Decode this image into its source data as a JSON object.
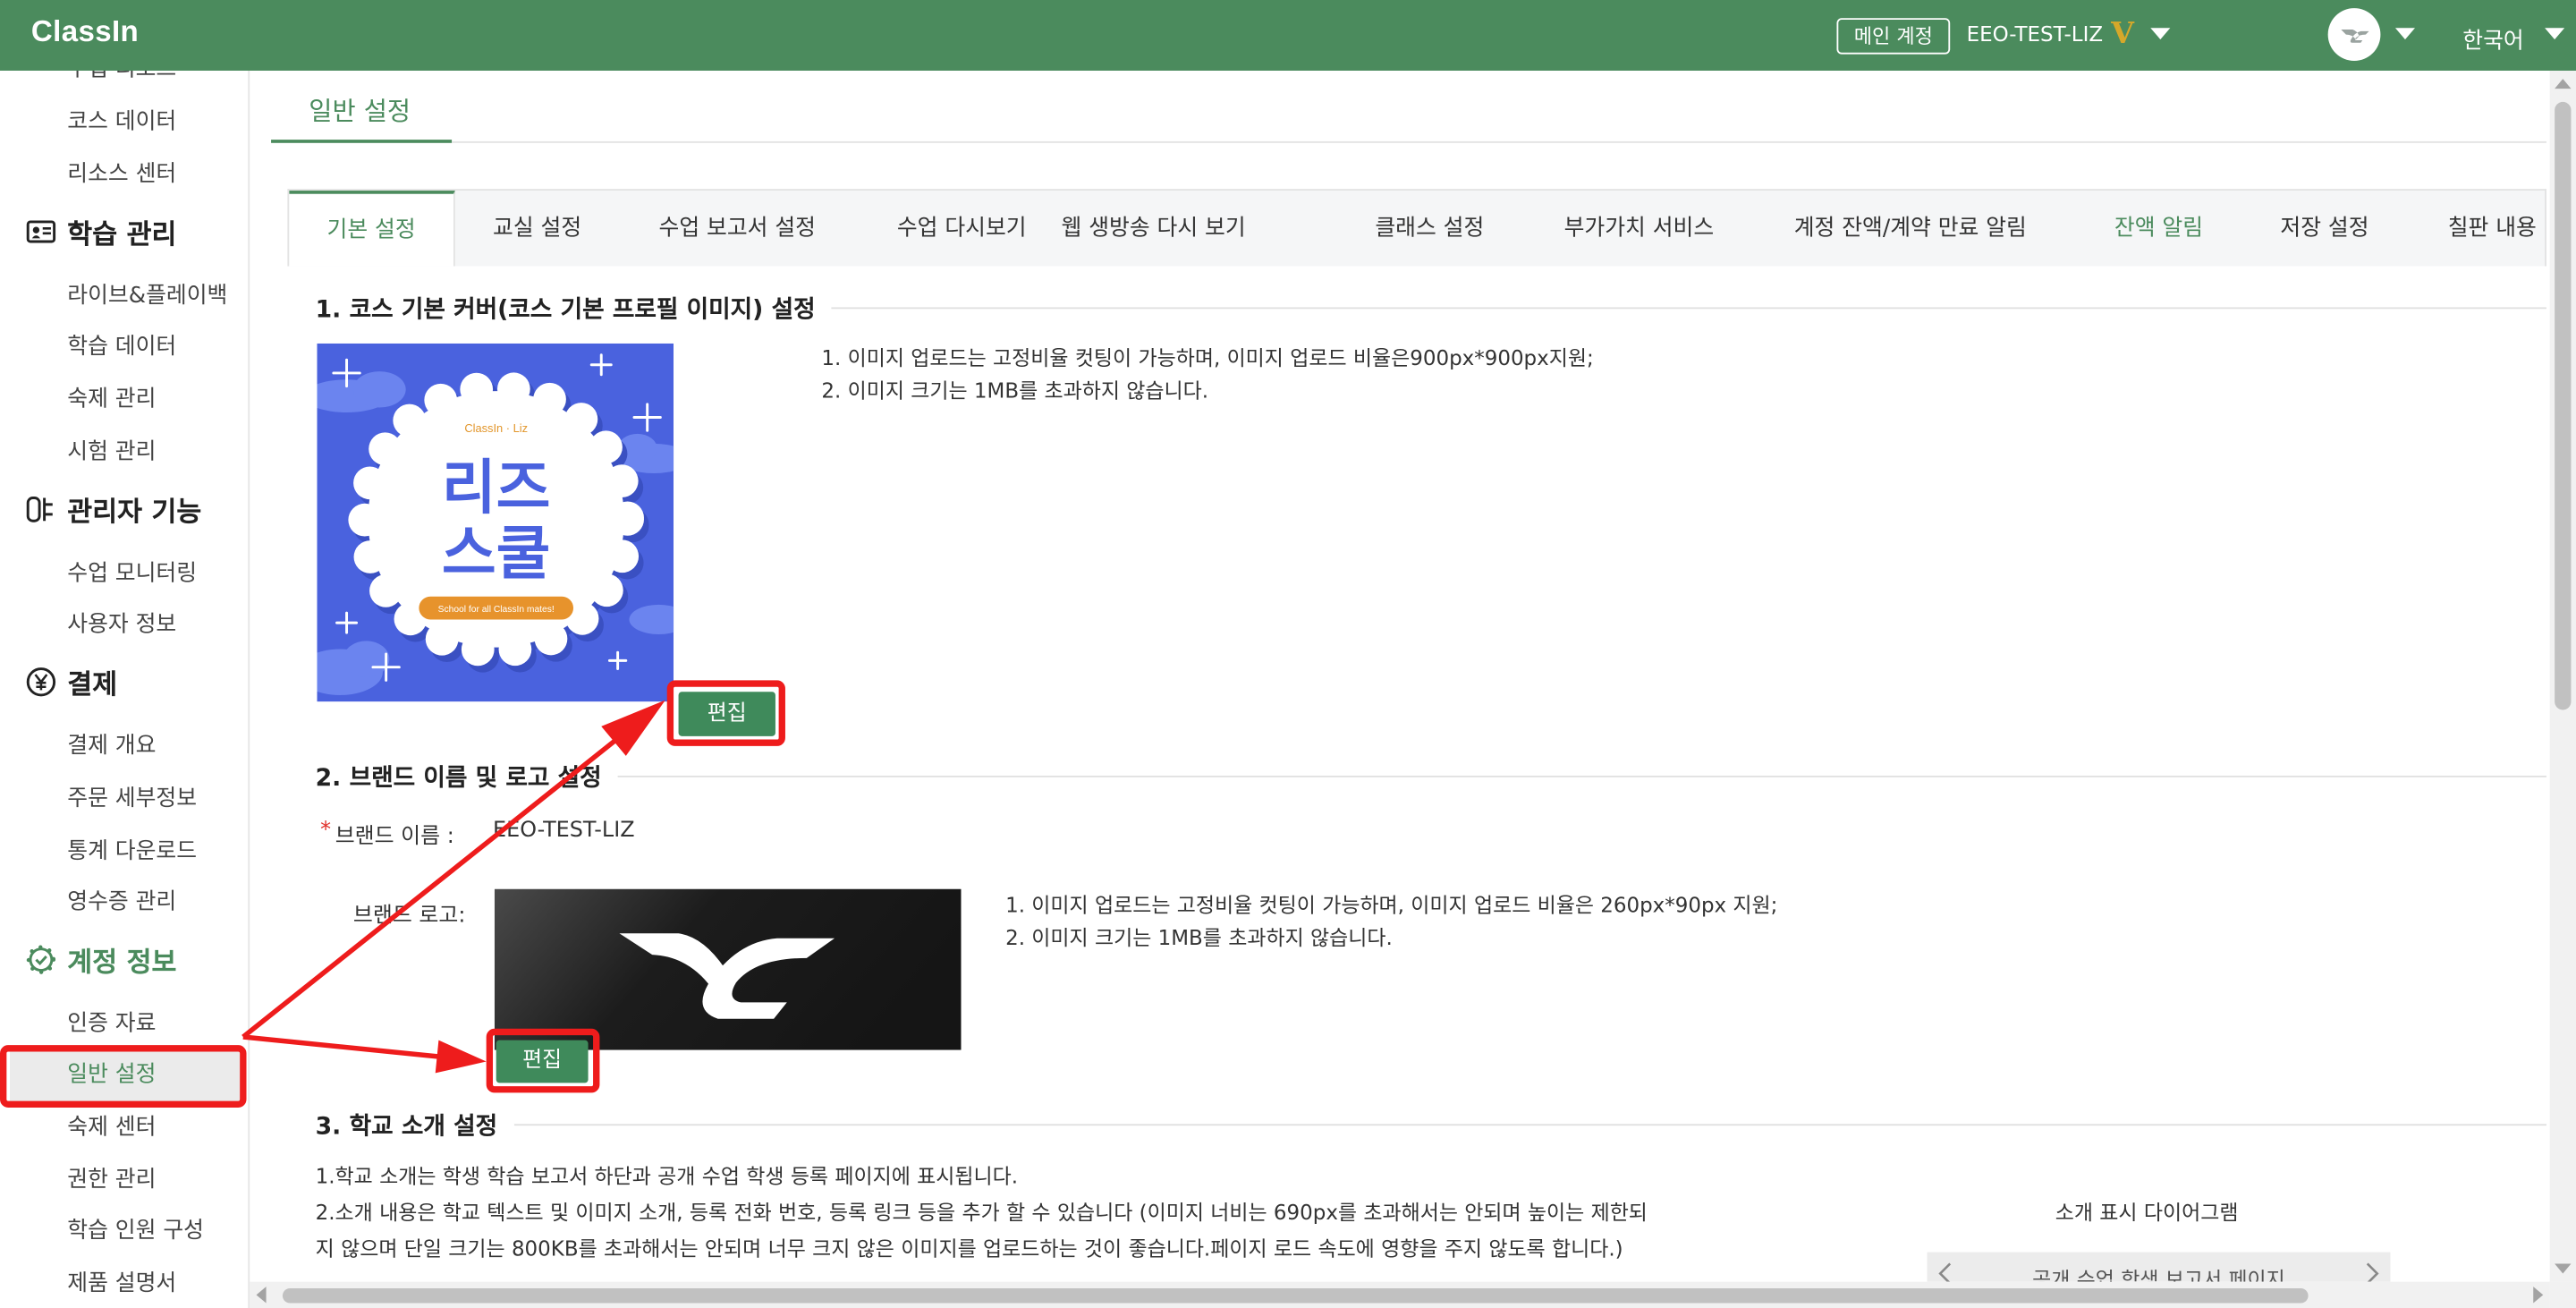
{
  "header": {
    "logo": "ClassIn",
    "main_account_label": "메인 계정",
    "account_name": "EEO-TEST-LIZ",
    "vip_badge": "V",
    "language": "한국어"
  },
  "sidebar": {
    "groups": [
      {
        "title": "",
        "items": [
          "수업 리소스",
          "코스 데이터",
          "리소스 센터"
        ]
      },
      {
        "title": "학습 관리",
        "icon": "id-card-icon",
        "items": [
          "라이브&플레이백",
          "학습 데이터",
          "숙제 관리",
          "시험 관리"
        ]
      },
      {
        "title": "관리자 기능",
        "icon": "admin-icon",
        "items": [
          "수업 모니터링",
          "사용자 정보"
        ]
      },
      {
        "title": "결제",
        "icon": "yen-icon",
        "items": [
          "결제 개요",
          "주문 세부정보",
          "통계 다운로드",
          "영수증 관리"
        ]
      },
      {
        "title": "계정 정보",
        "icon": "account-badge-icon",
        "items": [
          "인증 자료",
          "일반 설정",
          "숙제 센터",
          "권한 관리",
          "학습 인원 구성",
          "제품 설명서"
        ]
      }
    ],
    "active_item": "일반 설정"
  },
  "page": {
    "title": "일반 설정",
    "tabs": [
      "기본 설정",
      "교실 설정",
      "수업 보고서 설정",
      "수업 다시보기",
      "웹 생방송 다시 보기",
      "클래스 설정",
      "부가가치 서비스",
      "계정 잔액/계약 만료 알림",
      "잔액 알림",
      "저장 설정",
      "칠판 내용"
    ],
    "active_tab": "기본 설정"
  },
  "cover": {
    "title": "1. 코스 기본 커버(코스 기본 프로필 이미지) 설정",
    "notes": [
      "1. 이미지 업로드는 고정비율 컷팅이 가능하며, 이미지 업로드 비율은900px*900px지원;",
      "2. 이미지 크기는 1MB를 초과하지 않습니다."
    ],
    "edit_label": "편집",
    "image": {
      "brand": "ClassIn · Liz",
      "title_line1": "리즈",
      "title_line2": "스쿨",
      "tagline": "School for all ClassIn mates!"
    }
  },
  "brand": {
    "title": "2. 브랜드 이름 및 로고 설정",
    "required_mark": "*",
    "name_label": "브랜드 이름 :",
    "name_value": "EEO-TEST-LIZ",
    "logo_label": "브랜드 로고:",
    "notes": [
      "1. 이미지 업로드는 고정비율 컷팅이 가능하며, 이미지 업로드 비율은 260px*90px 지원;",
      "2. 이미지 크기는 1MB를 초과하지 않습니다."
    ],
    "edit_label": "편집"
  },
  "intro": {
    "title": "3. 학교 소개 설정",
    "lines": [
      "1.학교 소개는 학생 학습 보고서 하단과 공개 수업 학생 등록 페이지에 표시됩니다.",
      "2.소개 내용은 학교 텍스트 및 이미지 소개, 등록 전화 번호, 등록 링크 등을 추가 할 수 있습니다 (이미지 너비는 690px를 초과해서는 안되며 높이는 제한되",
      "지 않으며 단일 크기는 800KB를 초과해서는 안되며 너무 크지 않은 이미지를 업로드하는 것이 좋습니다.페이지 로드 속도에 영향을 주지 않도록 합니다.)"
    ],
    "diagram_label": "소개 표시 다이어그램",
    "preview_title": "공개 수업 학생 보고서 페이지"
  },
  "colors": {
    "brand_green": "#4b8b5d",
    "edit_button_green": "#3f8a5b",
    "highlight_red": "#ee1c1c",
    "cover_blue": "#4a62de",
    "vip_gold": "#d6a82a"
  }
}
